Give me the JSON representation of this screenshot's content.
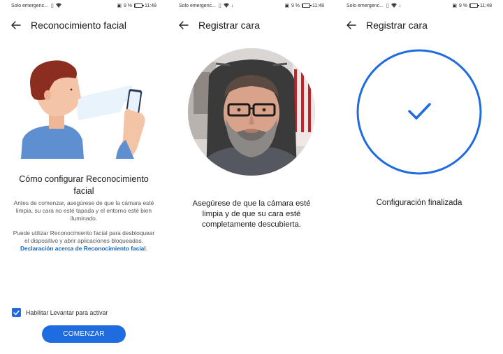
{
  "status_bar": {
    "carrier": "Solo emergenc...",
    "battery_text": "9 %",
    "time": "11:48",
    "battery_level": 0.09
  },
  "screen1": {
    "title": "Reconocimiento facial",
    "heading": "Cómo configurar Reconocimiento facial",
    "paragraph1": "Antes de comenzar, asegúrese de que la cámara esté limpia, su cara no esté tapada y el entorno esté bien iluminado.",
    "paragraph2_text": "Puede utilizar Reconocimiento facial para desbloquear el dispositivo y abrir aplicaciones bloqueadas.",
    "paragraph2_link": "Declaración acerca de Reconocimiento facial",
    "paragraph2_end": ".",
    "checkbox_label": "Habilitar Levantar para activar",
    "checkbox_checked": true,
    "start_button": "COMENZAR"
  },
  "screen2": {
    "title": "Registrar cara",
    "instruction": "Asegúrese de que la cámara esté limpia y de que su cara esté completamente descubierta."
  },
  "screen3": {
    "title": "Registrar cara",
    "done_text": "Configuración finalizada"
  },
  "colors": {
    "accent": "#1e6ce0",
    "link": "#1565c0",
    "battery_low": "#e53935"
  },
  "icons": [
    "back-arrow-icon",
    "checkmark-icon",
    "wifi-icon",
    "sim-icon",
    "vibrate-icon",
    "battery-icon",
    "download-icon"
  ]
}
